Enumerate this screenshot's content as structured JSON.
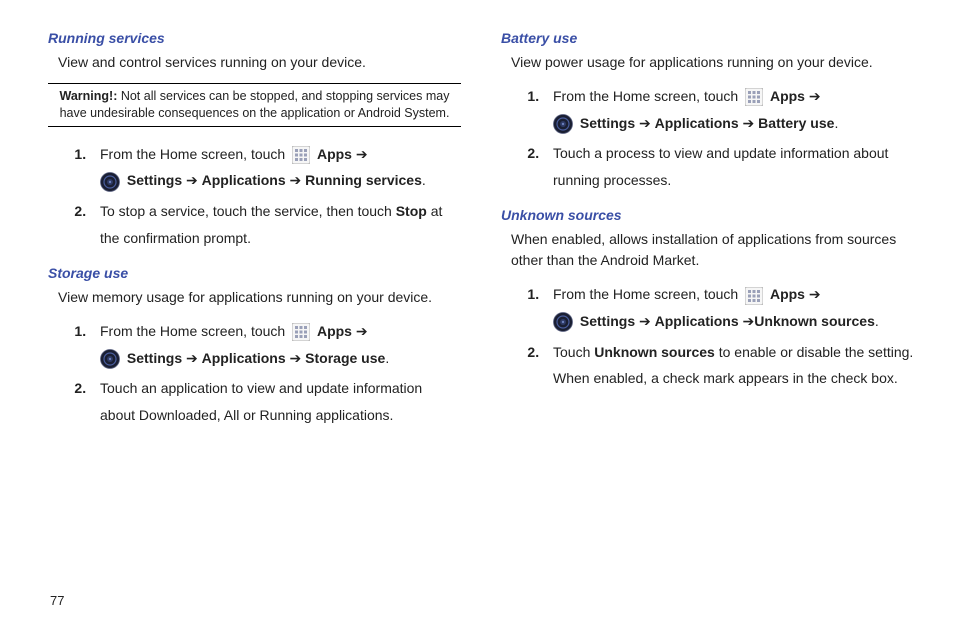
{
  "page_number": "77",
  "arrow": "➔",
  "icons": {
    "apps_label": "Apps",
    "settings_label": "Settings",
    "applications_label": "Applications"
  },
  "col1": {
    "s1": {
      "heading": "Running services",
      "desc": "View and control services running on your device.",
      "warning_label": "Warning!:",
      "warning_text": " Not all services can be stopped, and stopping services may have undesirable consequences on the application or Android System.",
      "step1_prefix": "From the Home screen, touch ",
      "step1_target": "Running services",
      "step2_a": "To stop a service, touch the service, then touch ",
      "step2_bold": "Stop",
      "step2_b": " at the confirmation prompt."
    },
    "s2": {
      "heading": "Storage use",
      "desc": "View memory usage for applications running on your device.",
      "step1_prefix": "From the Home screen, touch ",
      "step1_target": "Storage use",
      "step2": "Touch an application to view and update information about Downloaded, All or Running applications."
    }
  },
  "col2": {
    "s1": {
      "heading": "Battery use",
      "desc": "View power usage for applications running on your device.",
      "step1_prefix": "From the Home screen, touch ",
      "step1_target": "Battery use",
      "step2": "Touch a process to view and update information about running processes."
    },
    "s2": {
      "heading": "Unknown sources",
      "desc": "When enabled, allows installation of applications from sources other than the Android Market.",
      "step1_prefix": "From the Home screen, touch ",
      "step1_target": "Unknown sources",
      "step2_a": "Touch ",
      "step2_bold": "Unknown sources",
      "step2_b": " to enable or disable the setting. When enabled, a check mark appears in the check box."
    }
  }
}
